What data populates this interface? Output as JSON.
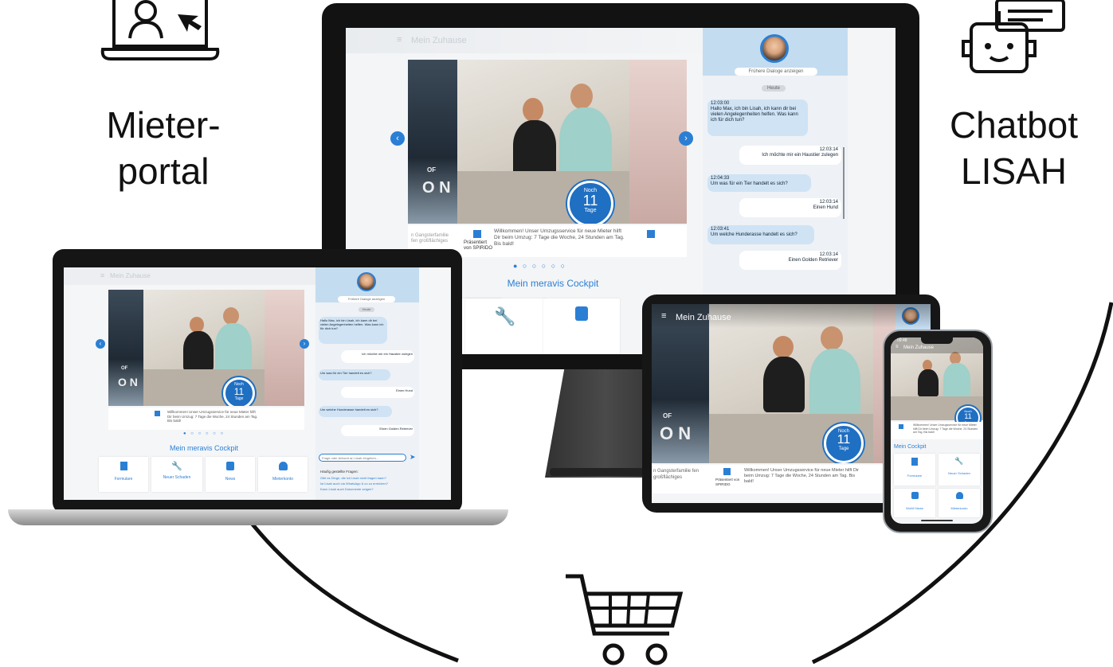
{
  "headings": {
    "left_line1": "Mieter-",
    "left_line2": "portal",
    "right_line1": "Chatbot",
    "right_line2": "LISAH"
  },
  "app": {
    "header_title": "Mein Zuhause",
    "badge_top": "Noch",
    "badge_number": "11",
    "badge_bottom": "Tage",
    "poster_text": "O N",
    "poster_of": "OF",
    "cockpit_title": "Mein meravis Cockpit",
    "cockpit_title_short": "Mein Cockpit",
    "carousel_dots": "● ○ ○ ○ ○ ○",
    "welcome_text": "Willkommen! Unser Umzugsservice für neue Mieter hilft Dir beim Umzug: 7 Tage die Woche, 24 Stunden am Tag. Bis bald!",
    "sponsor_text": "Präsentiert von SPIRIDO",
    "left_card_text": "n Gangsterfamilie fen großflächiges"
  },
  "tiles": [
    {
      "label": "Formulare",
      "icon": "document-icon"
    },
    {
      "label": "Neuer Schaden",
      "icon": "wrench-icon"
    },
    {
      "label": "News",
      "icon": "news-icon"
    },
    {
      "label": "Mieterkonto",
      "icon": "person-icon"
    }
  ],
  "tiles_phone": [
    {
      "label": "Formulare"
    },
    {
      "label": "Neuer Schaden"
    },
    {
      "label": "WoWi News"
    },
    {
      "label": "Mieterkonto"
    }
  ],
  "chat": {
    "earlier_dialogs": "Frühere Dialoge anzeigen",
    "today": "Heute",
    "messages": [
      {
        "from": "bot",
        "time": "12:03:00",
        "text": "Hallo Max, ich bin Lisah, ich kann dir bei vielen Angelegenheiten helfen. Was kann ich für dich tun?"
      },
      {
        "from": "user",
        "time": "12:03:14",
        "text": "Ich möchte mir ein Haustier zulegen"
      },
      {
        "from": "bot",
        "time": "12:04:33",
        "text": "Um was für ein Tier handelt es sich?"
      },
      {
        "from": "user",
        "time": "12:03:14",
        "text": "Einen Hund"
      },
      {
        "from": "bot",
        "time": "12:03:41",
        "text": "Um welche Hunderasse handelt es sich?"
      },
      {
        "from": "user",
        "time": "12:03:14",
        "text": "Einen Golden Retriever"
      }
    ],
    "input_placeholder": "Frage oder Antwort an Lisah eingeben...",
    "faq_title": "Häufig gestellte Fragen:",
    "faq": [
      "Gibt es Dinge, die ich Lisah nicht fragen kann?",
      "Ist Lisah auch via WhatsApp & co zu erreichen?",
      "Kann Lisah auch Dokumente zeigen?"
    ]
  },
  "phone_status": "09:48"
}
